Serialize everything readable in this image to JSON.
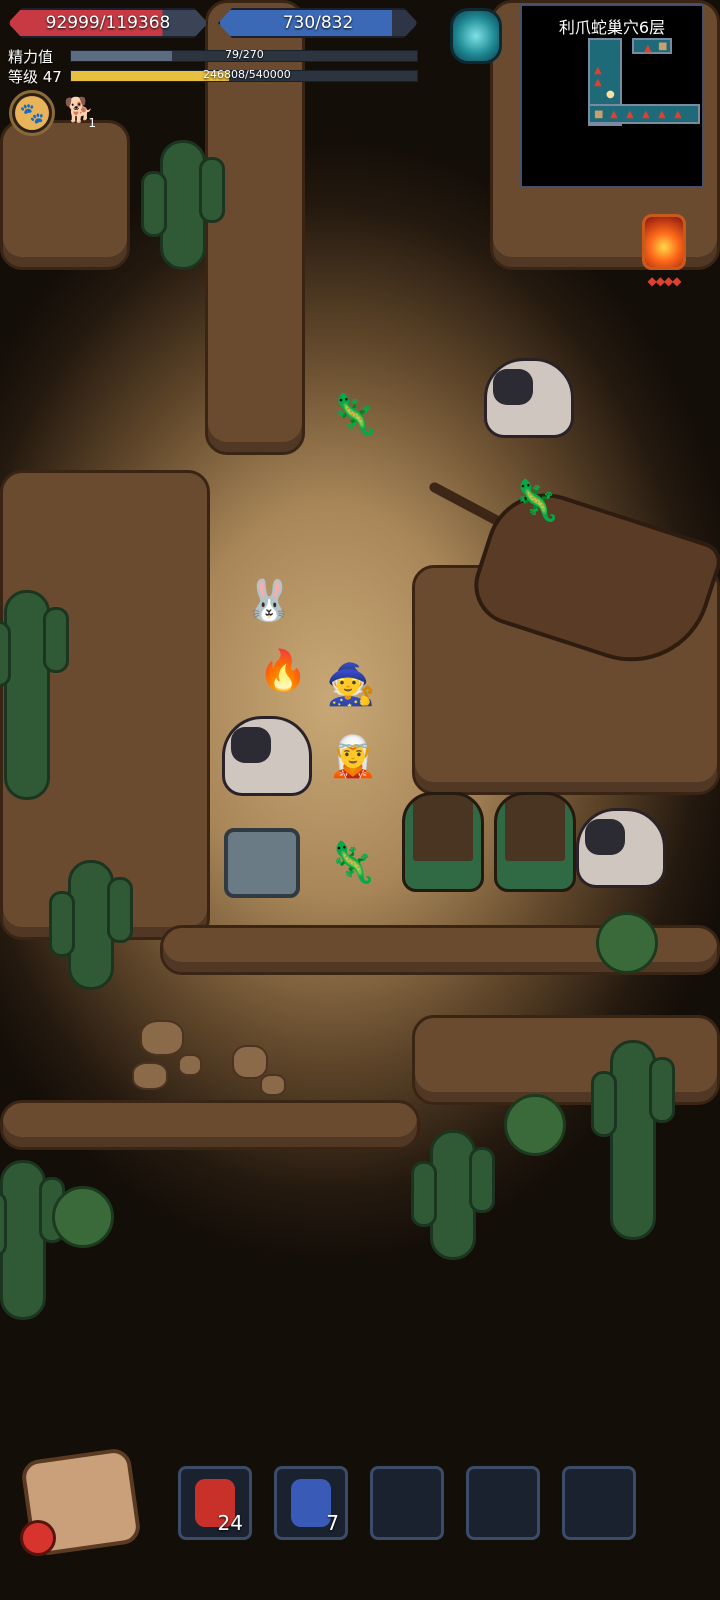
{
  "hud": {
    "hp": {
      "text": "92999/119368",
      "current": 92999,
      "max": 119368
    },
    "mp": {
      "text": "730/832",
      "current": 730,
      "max": 832
    },
    "stamina": {
      "label": "精力值",
      "text": "79/270",
      "current": 79,
      "max": 270,
      "color": "#5b6b80"
    },
    "level": {
      "label": "等级 47",
      "text": "246808/540000",
      "current": 246808,
      "max": 540000,
      "color": "#e8c040"
    },
    "pet_button_icon": "paw-icon",
    "buff": {
      "icon": "dog-plus-icon",
      "count": "1"
    },
    "portal_icon": "portal-icon"
  },
  "minimap": {
    "title": "利爪蛇巢穴6层",
    "colors": {
      "room": "#1e6a78",
      "enemy": "#e0402e",
      "chest": "#c8a070"
    }
  },
  "lantern": {
    "icon": "flame-lantern-icon",
    "pips": "◆◆◆◆"
  },
  "world": {
    "units": [
      {
        "name": "snake-enemy",
        "glyph": "🦎"
      },
      {
        "name": "boar-enemy",
        "glyph": ""
      },
      {
        "name": "snake-enemy",
        "glyph": "🦎"
      },
      {
        "name": "hero-bunny",
        "glyph": "🐰"
      },
      {
        "name": "hero-fire",
        "glyph": "🔥"
      },
      {
        "name": "hero-mage",
        "glyph": "🧙"
      },
      {
        "name": "hero-leader",
        "glyph": "🧝"
      },
      {
        "name": "pet-boar",
        "glyph": ""
      },
      {
        "name": "treasure-chest",
        "glyph": ""
      },
      {
        "name": "snake-enemy",
        "glyph": "🦎"
      },
      {
        "name": "treant-enemy",
        "glyph": ""
      },
      {
        "name": "treant-enemy",
        "glyph": ""
      },
      {
        "name": "boar-enemy",
        "glyph": ""
      }
    ]
  },
  "bottom": {
    "bag_icon": "backpack-icon",
    "slots": [
      {
        "icon": "red-potion-icon",
        "count": "24",
        "color": "#c8302a"
      },
      {
        "icon": "blue-elixir-icon",
        "count": "7",
        "color": "#3a5ab8"
      },
      {
        "icon": "",
        "count": ""
      },
      {
        "icon": "",
        "count": ""
      },
      {
        "icon": "",
        "count": ""
      }
    ]
  }
}
